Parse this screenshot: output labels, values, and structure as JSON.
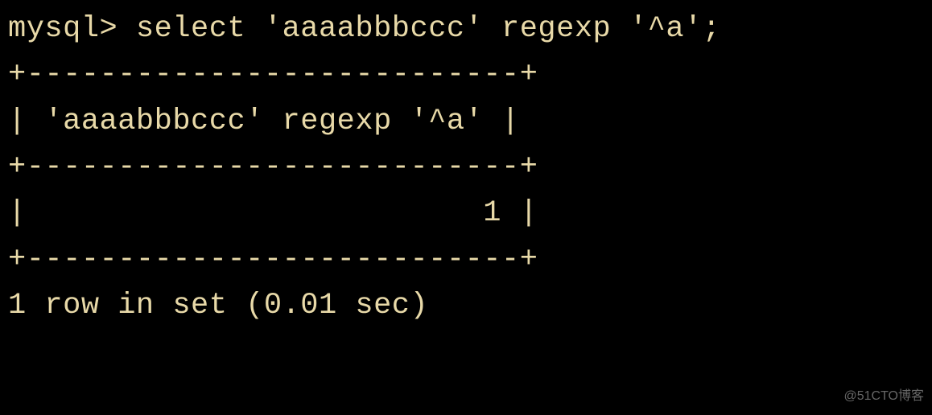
{
  "terminal": {
    "prompt": "mysql> ",
    "command": "select 'aaaabbbccc' regexp '^a';",
    "border_top": "+---------------------------+",
    "header_row": "| 'aaaabbbccc' regexp '^a' |",
    "border_mid": "+---------------------------+",
    "data_row": "|                         1 |",
    "border_bot": "+---------------------------+",
    "status": "1 row in set (0.01 sec)",
    "query": {
      "expression": "'aaaabbbccc' regexp '^a'",
      "result": 1,
      "rows": 1,
      "time_sec": 0.01
    }
  },
  "watermark": "@51CTO博客"
}
